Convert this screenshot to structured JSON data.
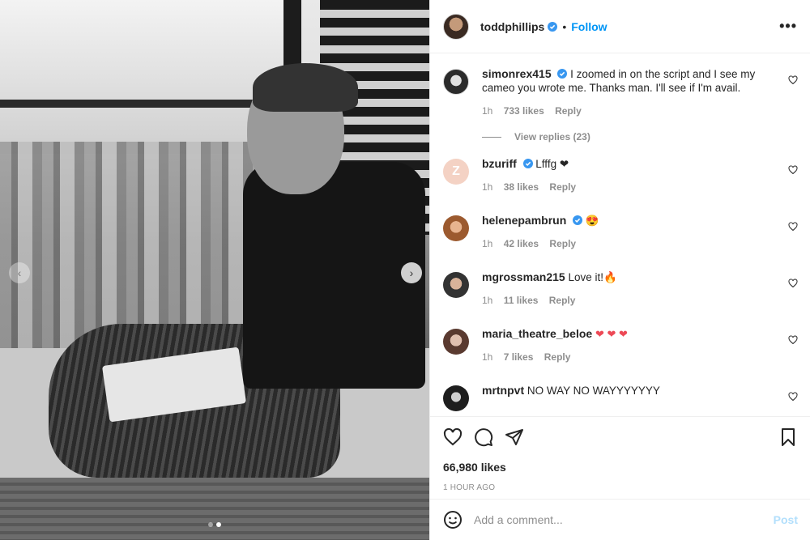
{
  "header": {
    "username": "toddphillips",
    "separator": "•",
    "follow_label": "Follow",
    "more_label": "•••"
  },
  "comments": [
    {
      "username": "simonrex415",
      "verified": true,
      "text": "I zoomed in on the script and I see my cameo you wrote me. Thanks man. I'll see if I'm avail.",
      "time": "1h",
      "likes": "733 likes",
      "reply": "Reply"
    },
    {
      "username": "bzuriff",
      "verified": true,
      "text": "Lfffg ❤",
      "time": "1h",
      "likes": "38 likes",
      "reply": "Reply"
    },
    {
      "username": "helenepambrun",
      "verified": true,
      "text": "😍",
      "time": "1h",
      "likes": "42 likes",
      "reply": "Reply"
    },
    {
      "username": "mgrossman215",
      "verified": false,
      "text": "Love it!🔥",
      "time": "1h",
      "likes": "11 likes",
      "reply": "Reply"
    },
    {
      "username": "maria_theatre_beloe",
      "verified": false,
      "text": "❤ ❤ ❤",
      "time": "1h",
      "likes": "7 likes",
      "reply": "Reply"
    },
    {
      "username": "mrtnpvt",
      "verified": false,
      "text": "NO WAY NO WAYYYYYYY",
      "time": "",
      "likes": "",
      "reply": ""
    }
  ],
  "view_replies": "View replies (23)",
  "actions": {
    "like_count": "66,980 likes",
    "timestamp": "1 HOUR AGO"
  },
  "add_comment": {
    "placeholder": "Add a comment...",
    "post_label": "Post"
  },
  "carousel": {
    "prev": "‹",
    "next": "›"
  },
  "colors": {
    "accent": "#0095f6",
    "verified": "#3897f0",
    "heart": "#ed4956",
    "muted": "#8e8e8e"
  }
}
